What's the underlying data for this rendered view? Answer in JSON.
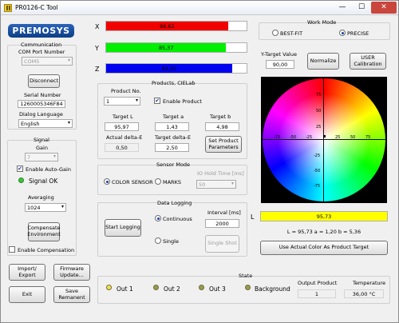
{
  "window": {
    "title": "PR0126-C Tool",
    "min_glyph": "—",
    "max_glyph": "☐",
    "close_glyph": "✕"
  },
  "logo": "PREMOSYS",
  "communication": {
    "title": "Communication",
    "com_port_label": "COM Port Number",
    "com_port_value": "COM5",
    "disconnect_label": "Disconnect",
    "serial_label": "Serial Number",
    "serial_value": "1260005346F84",
    "dialog_language_label": "Dialog Language",
    "dialog_language_value": "English"
  },
  "signal": {
    "title": "Signal",
    "gain_label": "Gain",
    "gain_value": "7",
    "auto_gain_label": "Enable Auto-Gain",
    "auto_gain_checked": true,
    "status_text": "Signal OK",
    "status_color": "#3cc43c",
    "averaging_label": "Averaging",
    "averaging_value": "1024",
    "compensate_label": "Compensate Environment",
    "enable_compensation_label": "Enable Compensation",
    "enable_compensation_checked": false
  },
  "bottom_buttons": {
    "import_export": "Import/ Export",
    "firmware_update": "Firmware Update...",
    "exit": "Exit",
    "save_remanent": "Save Remanent"
  },
  "xyz": [
    {
      "axis": "X",
      "value": "86,82",
      "color": "#f00000",
      "fraction": 0.868
    },
    {
      "axis": "Y",
      "value": "85,37",
      "color": "#00f000",
      "fraction": 0.854
    },
    {
      "axis": "Z",
      "value": "89,50",
      "color": "#0000f0",
      "fraction": 0.895
    }
  ],
  "products": {
    "title": "Products, CIELab",
    "product_no_label": "Product No.",
    "product_no_value": "1",
    "enable_product_label": "Enable Product",
    "enable_product_checked": true,
    "target_l_label": "Target L",
    "target_l_value": "95,97",
    "target_a_label": "Target a",
    "target_a_value": "1,43",
    "target_b_label": "Target b",
    "target_b_value": "4,98",
    "actual_delta_label": "Actual delta-E",
    "actual_delta_value": "0,50",
    "target_delta_label": "Target delta-E",
    "target_delta_value": "2,50",
    "set_params_label": "Set Product Parameters"
  },
  "sensor_mode": {
    "title": "Sensor Mode",
    "color_sensor_label": "COLOR SENSOR",
    "marks_label": "MARKS",
    "selected": "COLOR SENSOR",
    "io_hold_label": "IO Hold Time [ms]",
    "io_hold_value": "50"
  },
  "data_logging": {
    "title": "Data Logging",
    "start_logging_label": "Start Logging",
    "continuous_label": "Continuous",
    "single_label": "Single",
    "selected": "Continuous",
    "interval_label": "Interval [ms]",
    "interval_value": "2000",
    "single_shot_label": "Single Shot"
  },
  "work_mode": {
    "title": "Work Mode",
    "best_fit_label": "BEST-FIT",
    "precise_label": "PRECISE",
    "selected": "PRECISE",
    "y_target_label": "Y-Target Value",
    "y_target_value": "90,00",
    "normalize_label": "Normalize",
    "user_calibration_label": "USER Calibration"
  },
  "color_wheel": {
    "tick_labels_pos": [
      "25",
      "50",
      "75"
    ],
    "tick_labels_neg": [
      "-25",
      "-50",
      "-75"
    ],
    "marker": {
      "a": 1.2,
      "b": 5.36
    }
  },
  "lightness": {
    "label": "L",
    "value": "95,73",
    "color": "#ffff00",
    "fraction": 1.0,
    "readout": "L = 95,73   a = 1,20   b = 5,36",
    "use_actual_label": "Use Actual Color As Product Target"
  },
  "state": {
    "title": "State",
    "outputs": [
      {
        "label": "Out 1",
        "color": "#f2e24a"
      },
      {
        "label": "Out 2",
        "color": "#9a9a52"
      },
      {
        "label": "Out 3",
        "color": "#9a9a52"
      },
      {
        "label": "Background",
        "color": "#9a9a52"
      }
    ],
    "output_product_label": "Output Product",
    "output_product_value": "1",
    "temperature_label": "Temperature",
    "temperature_value": "36,00 °C"
  }
}
